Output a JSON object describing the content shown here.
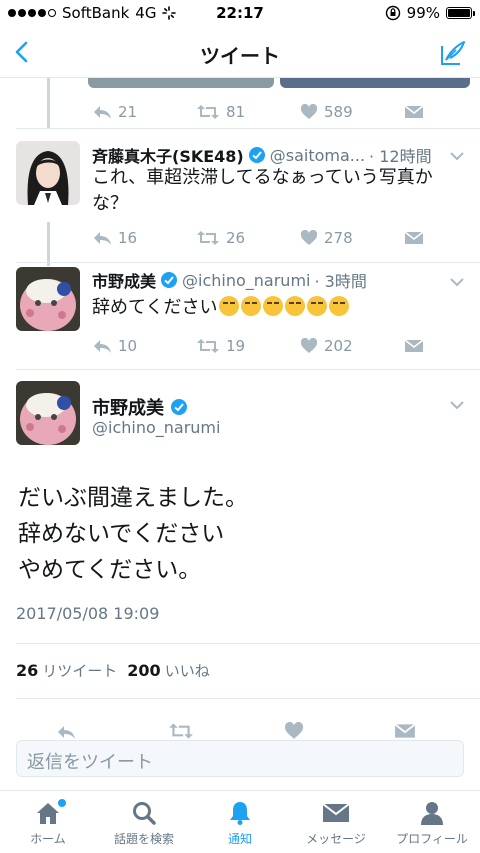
{
  "status_bar": {
    "carrier": "SoftBank",
    "network": "4G",
    "time": "22:17",
    "battery": "99%",
    "battery_level": 0.99
  },
  "nav": {
    "title": "ツイート",
    "back_icon": "chevron-left-icon",
    "compose_icon": "compose-icon"
  },
  "accent_color": "#1da1f2",
  "prev_tweet_actions": {
    "replies": "21",
    "retweets": "81",
    "likes": "589"
  },
  "tweets": [
    {
      "name": "斉藤真木子(SKE48)",
      "handle": "@saitoma...",
      "time": "· 12時間",
      "text": "これ、車超渋滞してるなぁっていう写真かな？",
      "replies": "16",
      "retweets": "26",
      "likes": "278"
    },
    {
      "name": "市野成美",
      "handle": "@ichino_narumi",
      "time": "· 3時間",
      "text": "辞めてください",
      "emoji_count": 6,
      "replies": "10",
      "retweets": "19",
      "likes": "202"
    }
  ],
  "focused_tweet": {
    "name": "市野成美",
    "handle": "@ichino_narumi",
    "lines": [
      "だいぶ間違えました。",
      "辞めないでください",
      "やめてください。"
    ],
    "date": "2017/05/08 19:09",
    "retweet_count": "26",
    "retweet_label": "リツイート",
    "like_count": "200",
    "like_label": "いいね"
  },
  "reply": {
    "placeholder": "返信をツイート"
  },
  "tabs": [
    {
      "label": "ホーム",
      "icon": "home-icon"
    },
    {
      "label": "話題を検索",
      "icon": "search-icon"
    },
    {
      "label": "通知",
      "icon": "bell-icon"
    },
    {
      "label": "メッセージ",
      "icon": "envelope-icon"
    },
    {
      "label": "プロフィール",
      "icon": "person-icon"
    }
  ]
}
